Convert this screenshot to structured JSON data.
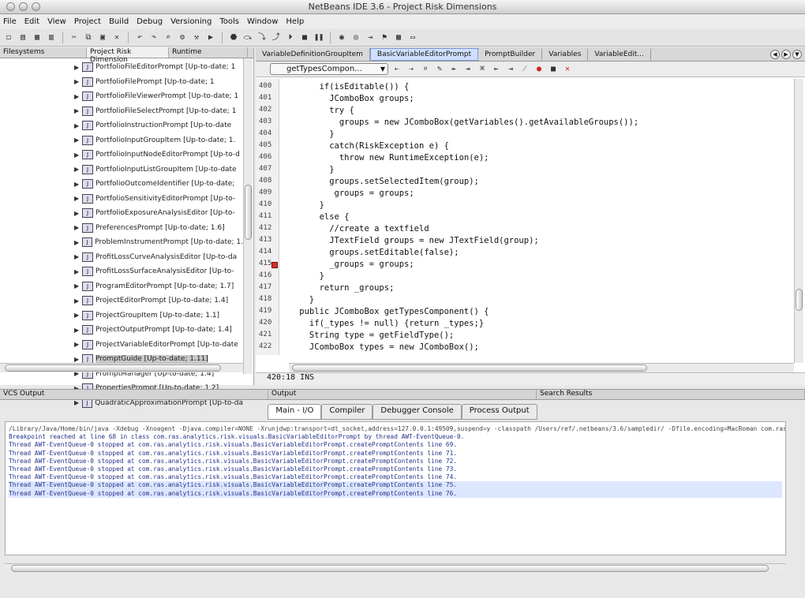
{
  "window": {
    "title": "NetBeans IDE 3.6 - Project Risk Dimensions"
  },
  "menu": [
    "File",
    "Edit",
    "View",
    "Project",
    "Build",
    "Debug",
    "Versioning",
    "Tools",
    "Window",
    "Help"
  ],
  "left_tabs": [
    "Filesystems",
    "Project Risk Dimension",
    "Runtime"
  ],
  "tree_items": [
    "PortfolioFileEditorPrompt [Up-to-date; 1",
    "PortfolioFilePrompt [Up-to-date; 1",
    "PortfolioFileViewerPrompt [Up-to-date; 1",
    "PortfolioFileSelectPrompt [Up-to-date; 1",
    "PortfolioInstructionPrompt [Up-to-date",
    "PortfolioInputGroupItem [Up-to-date; 1.",
    "PortfolioInputNodeEditorPrompt [Up-to-d",
    "PortfolioInputListGroupItem [Up-to-date",
    "PortfolioOutcomeIdentifier [Up-to-date;",
    "PortfolioSensitivityEditorPrompt [Up-to-",
    "PortfolioExposureAnalysisEditor [Up-to-",
    "PreferencesPrompt [Up-to-date; 1.6]",
    "ProblemInstrumentPrompt [Up-to-date; 1.",
    "ProfitLossCurveAnalysisEditor [Up-to-da",
    "ProfitLossSurfaceAnalysisEditor [Up-to-",
    "ProgramEditorPrompt [Up-to-date; 1.7]",
    "ProjectEditorPrompt [Up-to-date; 1.4]",
    "ProjectGroupItem [Up-to-date; 1.1]",
    "ProjectOutputPrompt [Up-to-date; 1.4]",
    "ProjectVariableEditorPrompt [Up-to-date",
    "PromptGuide [Up-to-date; 1.11]",
    "PromptManager [Up-to-date; 1.4]",
    "PropertiesPrompt [Up-to-date; 1.2]",
    "QuadraticApproximationPrompt [Up-to-da"
  ],
  "selected_tree_index": 20,
  "editor_tabs": [
    "VariableDefinitionGroupItem",
    "BasicVariableEditorPrompt",
    "PromptBuilder",
    "Variables",
    "VariableEdit..."
  ],
  "active_editor_tab": 1,
  "combo_value": "getTypesCompon...",
  "code_lines": [
    {
      "num": "400",
      "text": "        if(isEditable()) {"
    },
    {
      "num": "401",
      "text": "          JComboBox groups;"
    },
    {
      "num": "402",
      "text": "          try {"
    },
    {
      "num": "403",
      "text": "            groups = new JComboBox(getVariables().getAvailableGroups());"
    },
    {
      "num": "404",
      "text": "          }"
    },
    {
      "num": "405",
      "text": "          catch(RiskException e) {"
    },
    {
      "num": "406",
      "text": "            throw new RuntimeException(e);"
    },
    {
      "num": "407",
      "text": "          }"
    },
    {
      "num": "408",
      "text": "          groups.setSelectedItem(group);"
    },
    {
      "num": "409",
      "text": "           groups = groups;"
    },
    {
      "num": "410",
      "text": "        }"
    },
    {
      "num": "411",
      "text": "        else {"
    },
    {
      "num": "412",
      "text": "          //create a textfield"
    },
    {
      "num": "413",
      "text": "          JTextField groups = new JTextField(group);"
    },
    {
      "num": "414",
      "text": "          groups.setEditable(false);"
    },
    {
      "num": "415",
      "text": "          _groups = groups;"
    },
    {
      "num": "416",
      "text": "        }"
    },
    {
      "num": "417",
      "text": "        return _groups;"
    },
    {
      "num": "418",
      "text": "      }"
    },
    {
      "num": "419",
      "text": "    public JComboBox getTypesComponent() {"
    },
    {
      "num": "420",
      "text": "      if(_types != null) {return _types;}"
    },
    {
      "num": "421",
      "text": "      String type = getFieldType();"
    },
    {
      "num": "422",
      "text": "      JComboBox types = new JComboBox();"
    }
  ],
  "error_line_index": 15,
  "cursor_status": "420:18  INS",
  "output_header": [
    "VCS Output",
    "Output",
    "Search Results"
  ],
  "output_tabs": [
    "Main - I/O",
    "Compiler",
    "Debugger Console",
    "Process Output"
  ],
  "active_output_tab": 0,
  "output_lines": [
    "/Library/Java/Home/bin/java -Xdebug -Xnoagent -Djava.compiler=NONE -Xrunjdwp:transport=dt_socket,address=127.0.0.1:49509,suspend=y -classpath /Users/ref/.netbeans/3.6/sampledir/ -Dfile.encoding=MacRoman com.ras.analytics.risk.Main",
    "Breakpoint reached at line 68 in class com.ras.analytics.risk.visuals.BasicVariableEditorPrompt by thread AWT-EventQueue-0.",
    "Thread AWT-EventQueue-0 stopped at com.ras.analytics.risk.visuals.BasicVariableEditorPrompt.createPromptContents line 69.",
    "Thread AWT-EventQueue-0 stopped at com.ras.analytics.risk.visuals.BasicVariableEditorPrompt.createPromptContents line 71.",
    "Thread AWT-EventQueue-0 stopped at com.ras.analytics.risk.visuals.BasicVariableEditorPrompt.createPromptContents line 72.",
    "Thread AWT-EventQueue-0 stopped at com.ras.analytics.risk.visuals.BasicVariableEditorPrompt.createPromptContents line 73.",
    "Thread AWT-EventQueue-0 stopped at com.ras.analytics.risk.visuals.BasicVariableEditorPrompt.createPromptContents line 74.",
    "Thread AWT-EventQueue-0 stopped at com.ras.analytics.risk.visuals.BasicVariableEditorPrompt.createPromptContents line 75.",
    "Thread AWT-EventQueue-0 stopped at com.ras.analytics.risk.visuals.BasicVariableEditorPrompt.createPromptContents line 76."
  ]
}
